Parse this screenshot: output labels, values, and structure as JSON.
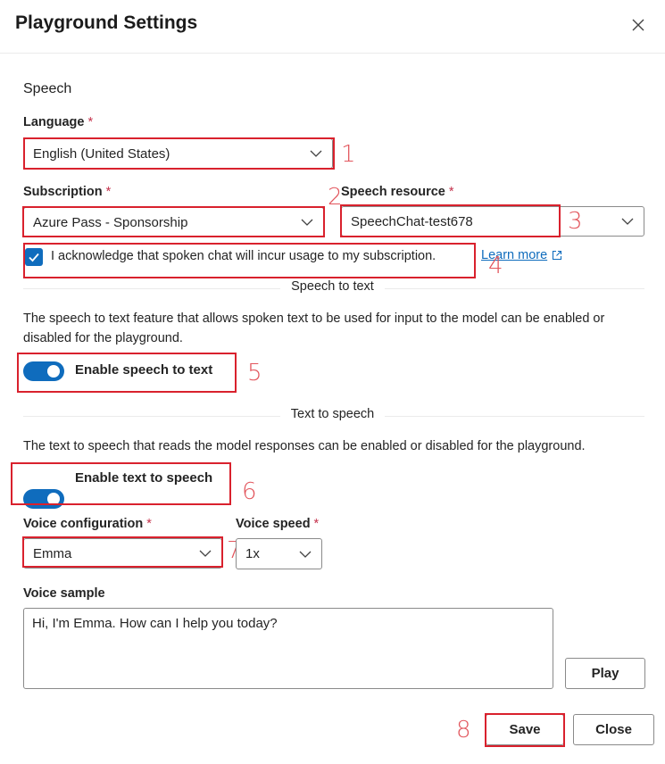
{
  "dialog": {
    "title": "Playground Settings"
  },
  "speech": {
    "section_title": "Speech",
    "language": {
      "label": "Language",
      "required": "*",
      "value": "English (United States)"
    },
    "subscription": {
      "label": "Subscription",
      "required": "*",
      "value": "Azure Pass - Sponsorship"
    },
    "speech_resource": {
      "label": "Speech resource",
      "required": "*",
      "value": "SpeechChat-test678"
    },
    "acknowledge": {
      "checked": true,
      "text": "I acknowledge that spoken chat will incur usage to my subscription.",
      "link": "Learn more"
    }
  },
  "speech_to_text": {
    "separator": "Speech to text",
    "description": "The speech to text feature that allows spoken text to be used for input to the model can be enabled or disabled for the playground.",
    "toggle_label": "Enable speech to text",
    "enabled": true
  },
  "text_to_speech": {
    "separator": "Text to speech",
    "description": "The text to speech that reads the model responses can be enabled or disabled for the playground.",
    "toggle_label": "Enable text to speech",
    "enabled": true,
    "voice_config": {
      "label": "Voice configuration",
      "required": "*",
      "value": "Emma"
    },
    "voice_speed": {
      "label": "Voice speed",
      "required": "*",
      "value": "1x"
    },
    "voice_sample": {
      "label": "Voice sample",
      "value": "Hi, I'm Emma. How can I help you today?"
    },
    "play_label": "Play"
  },
  "footer": {
    "save_label": "Save",
    "close_label": "Close"
  },
  "callouts": [
    "1",
    "2",
    "3",
    "4",
    "5",
    "6",
    "7",
    "8"
  ],
  "colors": {
    "accent": "#0f6cbd",
    "annotation_red": "#d9212d",
    "required": "#c4314b"
  }
}
